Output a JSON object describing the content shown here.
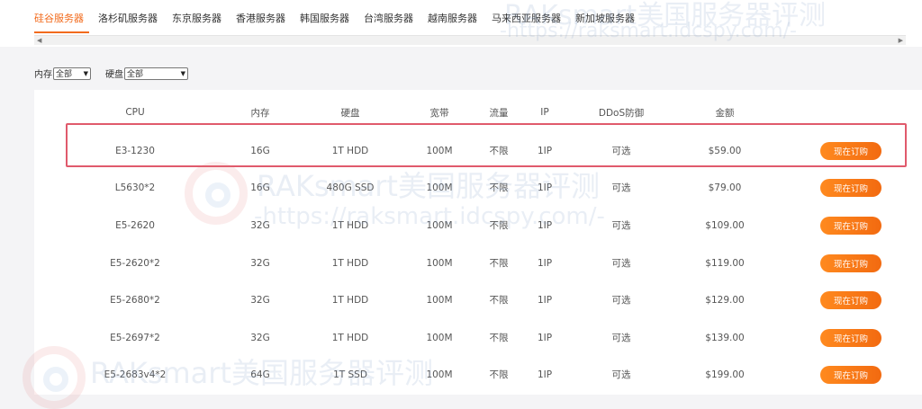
{
  "tabs": [
    {
      "label": "硅谷服务器",
      "active": true
    },
    {
      "label": "洛杉矶服务器",
      "active": false
    },
    {
      "label": "东京服务器",
      "active": false
    },
    {
      "label": "香港服务器",
      "active": false
    },
    {
      "label": "韩国服务器",
      "active": false
    },
    {
      "label": "台湾服务器",
      "active": false
    },
    {
      "label": "越南服务器",
      "active": false
    },
    {
      "label": "马来西亚服务器",
      "active": false
    },
    {
      "label": "新加坡服务器",
      "active": false
    }
  ],
  "filters": {
    "memory": {
      "label": "内存",
      "value": "全部"
    },
    "disk": {
      "label": "硬盘",
      "value": "全部"
    }
  },
  "table": {
    "headers": {
      "cpu": "CPU",
      "mem": "内存",
      "disk": "硬盘",
      "bw": "宽带",
      "traffic": "流量",
      "ip": "IP",
      "ddos": "DDoS防御",
      "price": "金额"
    },
    "rows": [
      {
        "cpu": "E3-1230",
        "mem": "16G",
        "disk": "1T HDD",
        "bw": "100M",
        "traffic": "不限",
        "ip": "1IP",
        "ddos": "可选",
        "price": "$59.00",
        "action": "现在订购"
      },
      {
        "cpu": "L5630*2",
        "mem": "16G",
        "disk": "480G SSD",
        "bw": "100M",
        "traffic": "不限",
        "ip": "1IP",
        "ddos": "可选",
        "price": "$79.00",
        "action": "现在订购"
      },
      {
        "cpu": "E5-2620",
        "mem": "32G",
        "disk": "1T HDD",
        "bw": "100M",
        "traffic": "不限",
        "ip": "1IP",
        "ddos": "可选",
        "price": "$109.00",
        "action": "现在订购"
      },
      {
        "cpu": "E5-2620*2",
        "mem": "32G",
        "disk": "1T HDD",
        "bw": "100M",
        "traffic": "不限",
        "ip": "1IP",
        "ddos": "可选",
        "price": "$119.00",
        "action": "现在订购"
      },
      {
        "cpu": "E5-2680*2",
        "mem": "32G",
        "disk": "1T HDD",
        "bw": "100M",
        "traffic": "不限",
        "ip": "1IP",
        "ddos": "可选",
        "price": "$129.00",
        "action": "现在订购"
      },
      {
        "cpu": "E5-2697*2",
        "mem": "32G",
        "disk": "1T HDD",
        "bw": "100M",
        "traffic": "不限",
        "ip": "1IP",
        "ddos": "可选",
        "price": "$139.00",
        "action": "现在订购"
      },
      {
        "cpu": "E5-2683v4*2",
        "mem": "64G",
        "disk": "1T SSD",
        "bw": "100M",
        "traffic": "不限",
        "ip": "1IP",
        "ddos": "可选",
        "price": "$199.00",
        "action": "现在订购"
      }
    ]
  },
  "watermark": {
    "brand": "RAKsmart美国服务器评测",
    "url": "-https://raksmart.idcspy.com/-"
  },
  "colors": {
    "accent": "#f26b1d",
    "highlight_border": "#e05a6c"
  }
}
